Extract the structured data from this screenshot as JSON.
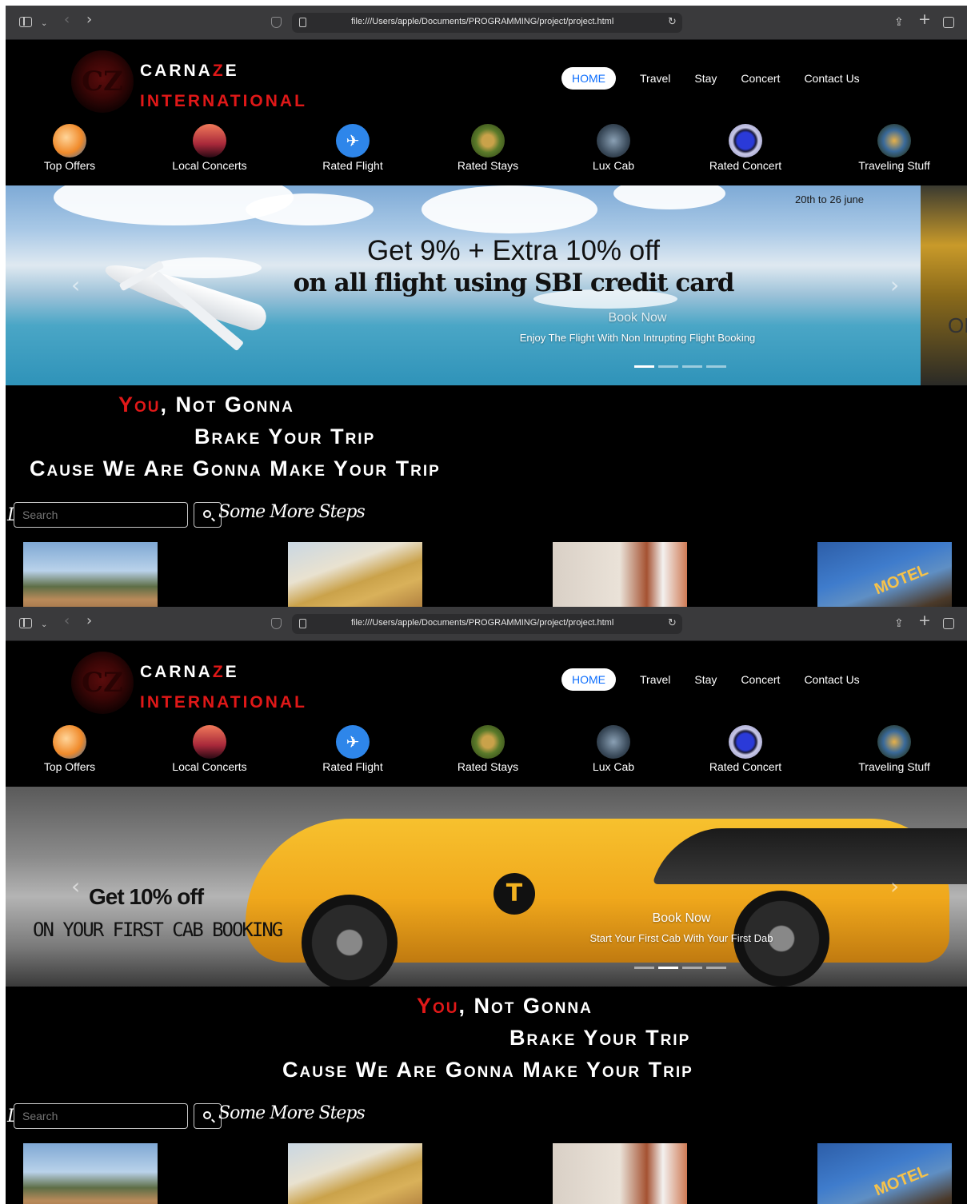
{
  "browser": {
    "url": "file:///Users/apple/Documents/PROGRAMMING/project/project.html"
  },
  "site": {
    "brand_line1_a": "CARNA",
    "brand_line1_z": "Z",
    "brand_line1_b": "E",
    "brand_line2": "INTERNATIONAL",
    "nav": [
      "HOME",
      "Travel",
      "Stay",
      "Concert",
      "Contact Us"
    ],
    "categories": [
      {
        "label": "Top Offers",
        "icon": "top-offers-icon"
      },
      {
        "label": "Local Concerts",
        "icon": "local-concerts-icon"
      },
      {
        "label": "Rated Flight",
        "icon": "airplane-icon"
      },
      {
        "label": "Rated Stays",
        "icon": "rated-stays-icon"
      },
      {
        "label": "Lux Cab",
        "icon": "lux-cab-icon"
      },
      {
        "label": "Rated Concert",
        "icon": "rated-concert-icon"
      },
      {
        "label": "Traveling Stuff",
        "icon": "traveling-stuff-icon"
      }
    ],
    "tagline": {
      "you": "You",
      "line1_rest": ", Not Gonna",
      "line2": "Brake Your Trip",
      "line3": "Cause We Are Gonna Make Your Trip"
    },
    "search": {
      "placeholder": "Search"
    },
    "section_title": "Some More Steps",
    "thumb_text_motel": "MOTEL"
  },
  "screen_a": {
    "slide": {
      "date": "20th to 26 june",
      "headline_a": "Get  9% + Extra 10% off",
      "headline_b": "on all flight using SBI credit card",
      "caption_title": "Book Now",
      "caption_sub": "Enjoy The Flight With Non Intrupting Flight Booking",
      "next_peek": "ON",
      "active_indicator": 1
    }
  },
  "screen_b": {
    "slide": {
      "offer1": "Get 10% off",
      "offer2": "ON YOUR FIRST CAB BOOKING",
      "caption_title": "Book Now",
      "caption_sub": "Start Your First Cab With Your First Dab",
      "cab_logo": "T",
      "active_indicator": 2
    }
  },
  "colors": {
    "brand_red": "#e01818",
    "nav_active_text": "#0d6efd",
    "background": "#000000"
  }
}
